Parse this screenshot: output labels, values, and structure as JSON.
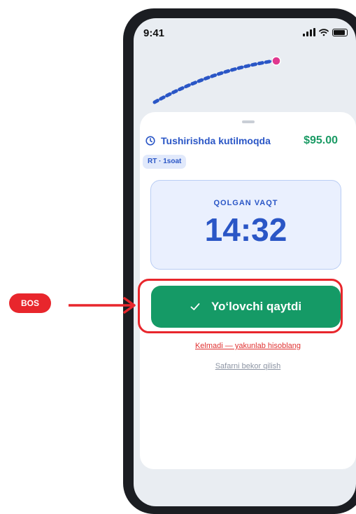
{
  "status_bar": {
    "time": "9:41"
  },
  "ride": {
    "status": "Tushirishda kutilmoqda",
    "price": "$95.00",
    "tag": "RT · 1soat"
  },
  "timer": {
    "label": "QOLGAN VAQT",
    "value": "14:32"
  },
  "actions": {
    "primary_label": "Yo‘lovchi qaytdi",
    "finish_link": "Kelmadi — yakunlab hisoblang",
    "cancel_link": "Safarni bekor qilish"
  },
  "annotation": {
    "badge": "BOS"
  },
  "colors": {
    "accent_blue": "#2a56c6",
    "success_green": "#159a66",
    "price_green": "#1a9a64",
    "danger_red": "#e03131",
    "annotation_red": "#e8262c",
    "route_pin": "#e0388f"
  },
  "icons": {
    "status": [
      "signal-icon",
      "wifi-icon",
      "battery-icon"
    ],
    "ride_status": "clock-icon",
    "primary_button": "check-icon"
  }
}
